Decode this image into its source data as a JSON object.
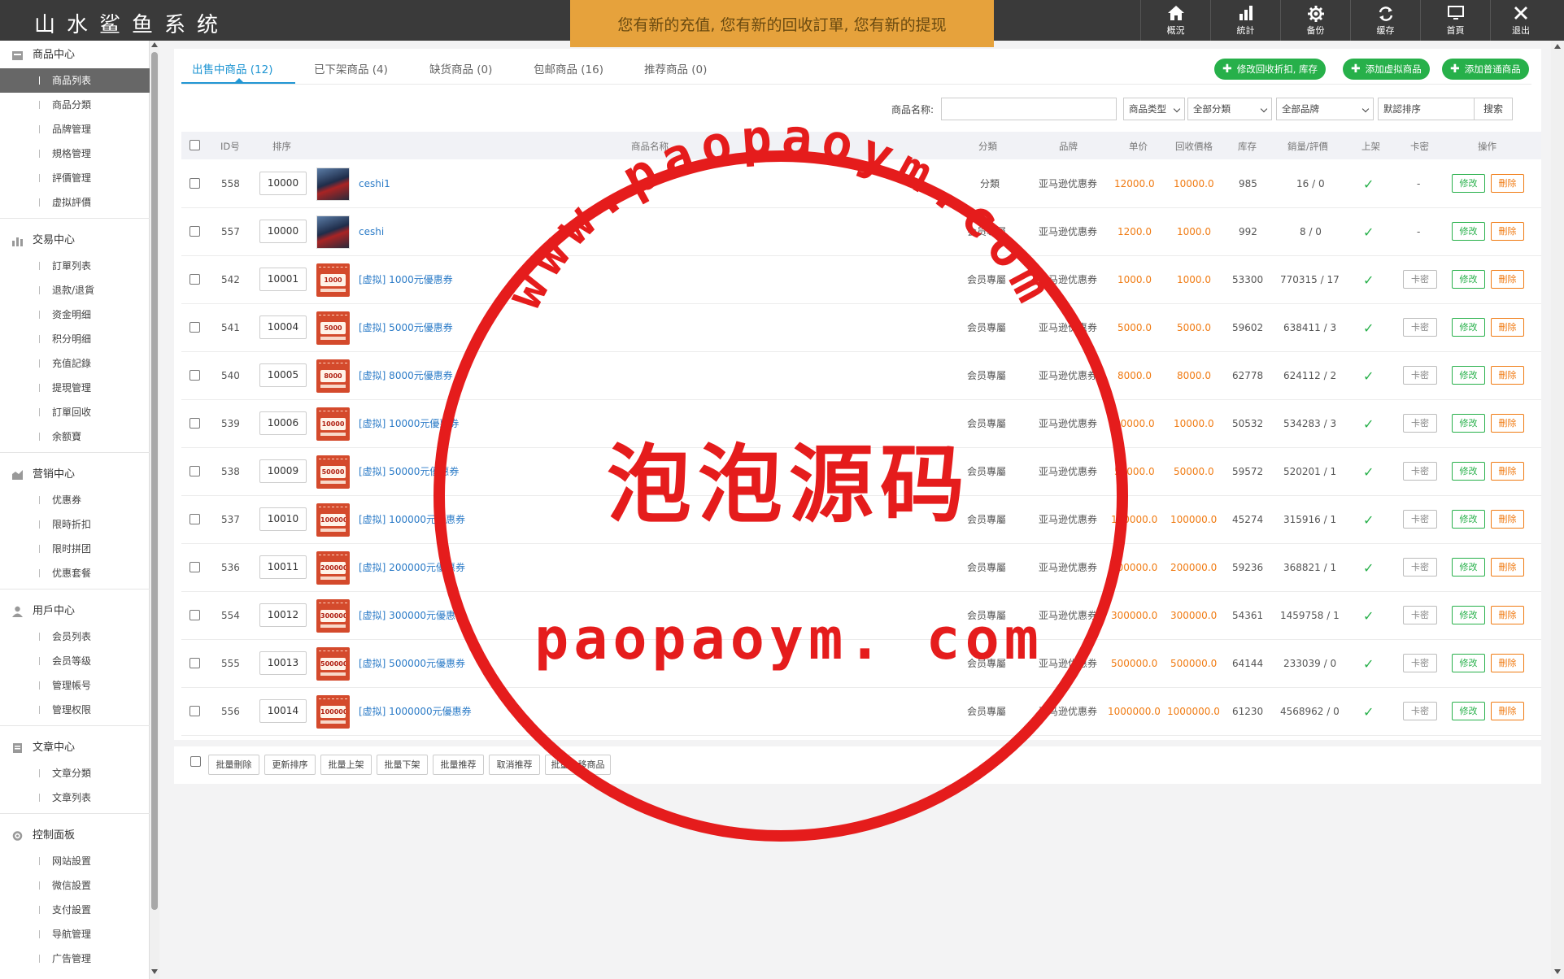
{
  "header": {
    "title": "山水鲨鱼系统",
    "notice": "您有新的充值, 您有新的回收訂單, 您有新的提现",
    "nav": [
      {
        "label": "概況",
        "icon": "home-icon"
      },
      {
        "label": "統計",
        "icon": "bar-chart-icon"
      },
      {
        "label": "备份",
        "icon": "gear-icon"
      },
      {
        "label": "缓存",
        "icon": "refresh-icon"
      },
      {
        "label": "首頁",
        "icon": "monitor-icon"
      },
      {
        "label": "退出",
        "icon": "close-icon"
      }
    ]
  },
  "sidebar": {
    "groups": [
      {
        "title": "商品中心",
        "icon": "store-icon",
        "items": [
          "商品列表",
          "商品分類",
          "品牌管理",
          "規格管理",
          "評價管理",
          "虚拟評價"
        ]
      },
      {
        "title": "交易中心",
        "icon": "chart-icon",
        "items": [
          "訂單列表",
          "退款/退貨",
          "资金明细",
          "积分明细",
          "充值記錄",
          "提現管理",
          "訂單回收",
          "余额寶"
        ]
      },
      {
        "title": "营销中心",
        "icon": "marketing-icon",
        "items": [
          "优惠券",
          "限時折扣",
          "限时拼团",
          "优惠套餐"
        ]
      },
      {
        "title": "用戶中心",
        "icon": "user-icon",
        "items": [
          "会员列表",
          "会员等级",
          "管理帳号",
          "管理权限"
        ]
      },
      {
        "title": "文章中心",
        "icon": "document-icon",
        "items": [
          "文章分類",
          "文章列表"
        ]
      },
      {
        "title": "控制面板",
        "icon": "settings-icon",
        "items": [
          "网站設置",
          "微信設置",
          "支付設置",
          "导航管理",
          "广告管理"
        ]
      }
    ],
    "active": "商品列表"
  },
  "tabs": [
    "出售中商品 (12)",
    "已下架商品 (4)",
    "缺货商品 (0)",
    "包邮商品 (16)",
    "推荐商品 (0)"
  ],
  "actions": [
    "修改回收折扣, 库存",
    "添加虚拟商品",
    "添加普通商品"
  ],
  "search": {
    "label": "商品名称:",
    "value": "",
    "type": "商品类型",
    "category": "全部分類",
    "brand": "全部品牌",
    "sort": "默認排序",
    "button": "搜索"
  },
  "table": {
    "headers": [
      "ID号",
      "排序",
      "商品名称",
      "分類",
      "品牌",
      "单价",
      "回收價格",
      "库存",
      "銷量/評價",
      "上架",
      "卡密",
      "操作"
    ],
    "rows": [
      {
        "id": "558",
        "sort": "10000",
        "thumb": "person",
        "name": "ceshi1",
        "cat": "分類",
        "brand": "亚马逊优惠券",
        "price": "12000.0",
        "recycle": "10000.0",
        "stock": "985",
        "sales": "16 / 0",
        "km": "-"
      },
      {
        "id": "557",
        "sort": "10000",
        "thumb": "person",
        "name": "ceshi",
        "cat": "会员專屬",
        "brand": "亚马逊优惠券",
        "price": "1200.0",
        "recycle": "1000.0",
        "stock": "992",
        "sales": "8 / 0",
        "km": "-"
      },
      {
        "id": "542",
        "sort": "10001",
        "thumb": "1000",
        "name": "[虚拟] 1000元優惠券",
        "cat": "会员專屬",
        "brand": "亚马逊优惠券",
        "price": "1000.0",
        "recycle": "1000.0",
        "stock": "53300",
        "sales": "770315 / 17",
        "km": "卡密"
      },
      {
        "id": "541",
        "sort": "10004",
        "thumb": "5000",
        "name": "[虚拟] 5000元優惠券",
        "cat": "会员專屬",
        "brand": "亚马逊优惠券",
        "price": "5000.0",
        "recycle": "5000.0",
        "stock": "59602",
        "sales": "638411 / 3",
        "km": "卡密"
      },
      {
        "id": "540",
        "sort": "10005",
        "thumb": "8000",
        "name": "[虚拟] 8000元優惠券",
        "cat": "会员專屬",
        "brand": "亚马逊优惠券",
        "price": "8000.0",
        "recycle": "8000.0",
        "stock": "62778",
        "sales": "624112 / 2",
        "km": "卡密"
      },
      {
        "id": "539",
        "sort": "10006",
        "thumb": "10000",
        "name": "[虚拟] 10000元優惠券",
        "cat": "会员專屬",
        "brand": "亚马逊优惠券",
        "price": "10000.0",
        "recycle": "10000.0",
        "stock": "50532",
        "sales": "534283 / 3",
        "km": "卡密"
      },
      {
        "id": "538",
        "sort": "10009",
        "thumb": "50000",
        "name": "[虚拟] 50000元優惠券",
        "cat": "会员專屬",
        "brand": "亚马逊优惠券",
        "price": "50000.0",
        "recycle": "50000.0",
        "stock": "59572",
        "sales": "520201 / 1",
        "km": "卡密"
      },
      {
        "id": "537",
        "sort": "10010",
        "thumb": "100000",
        "name": "[虚拟] 100000元優惠券",
        "cat": "会员專屬",
        "brand": "亚马逊优惠券",
        "price": "100000.0",
        "recycle": "100000.0",
        "stock": "45274",
        "sales": "315916 / 1",
        "km": "卡密"
      },
      {
        "id": "536",
        "sort": "10011",
        "thumb": "200000",
        "name": "[虚拟] 200000元優惠券",
        "cat": "会员專屬",
        "brand": "亚马逊优惠券",
        "price": "200000.0",
        "recycle": "200000.0",
        "stock": "59236",
        "sales": "368821 / 1",
        "km": "卡密"
      },
      {
        "id": "554",
        "sort": "10012",
        "thumb": "300000",
        "name": "[虚拟] 300000元優惠券",
        "cat": "会员專屬",
        "brand": "亚马逊优惠券",
        "price": "300000.0",
        "recycle": "300000.0",
        "stock": "54361",
        "sales": "1459758 / 1",
        "km": "卡密"
      },
      {
        "id": "555",
        "sort": "10013",
        "thumb": "500000",
        "name": "[虚拟] 500000元優惠券",
        "cat": "会员專屬",
        "brand": "亚马逊优惠券",
        "price": "500000.0",
        "recycle": "500000.0",
        "stock": "64144",
        "sales": "233039 / 0",
        "km": "卡密"
      },
      {
        "id": "556",
        "sort": "10014",
        "thumb": "1000000",
        "name": "[虚拟] 1000000元優惠券",
        "cat": "会员專屬",
        "brand": "亚马逊优惠券",
        "price": "1000000.0",
        "recycle": "1000000.0",
        "stock": "61230",
        "sales": "4568962 / 0",
        "km": "卡密"
      }
    ],
    "edit_label": "修改",
    "delete_label": "刪除"
  },
  "batch": [
    "批量刪除",
    "更新排序",
    "批量上架",
    "批量下架",
    "批量推荐",
    "取消推荐",
    "批量上移商品"
  ],
  "watermark": {
    "arc_text": "www.paopaoym.com",
    "center_text": "泡泡源码",
    "bottom_text": "paopaoym. com"
  },
  "colors": {
    "accent": "#2196d3",
    "green": "#27b04a",
    "orange": "#f07b13",
    "notice": "#e6a23c",
    "header": "#3a3a3a",
    "stamp": "#e51c1c"
  }
}
